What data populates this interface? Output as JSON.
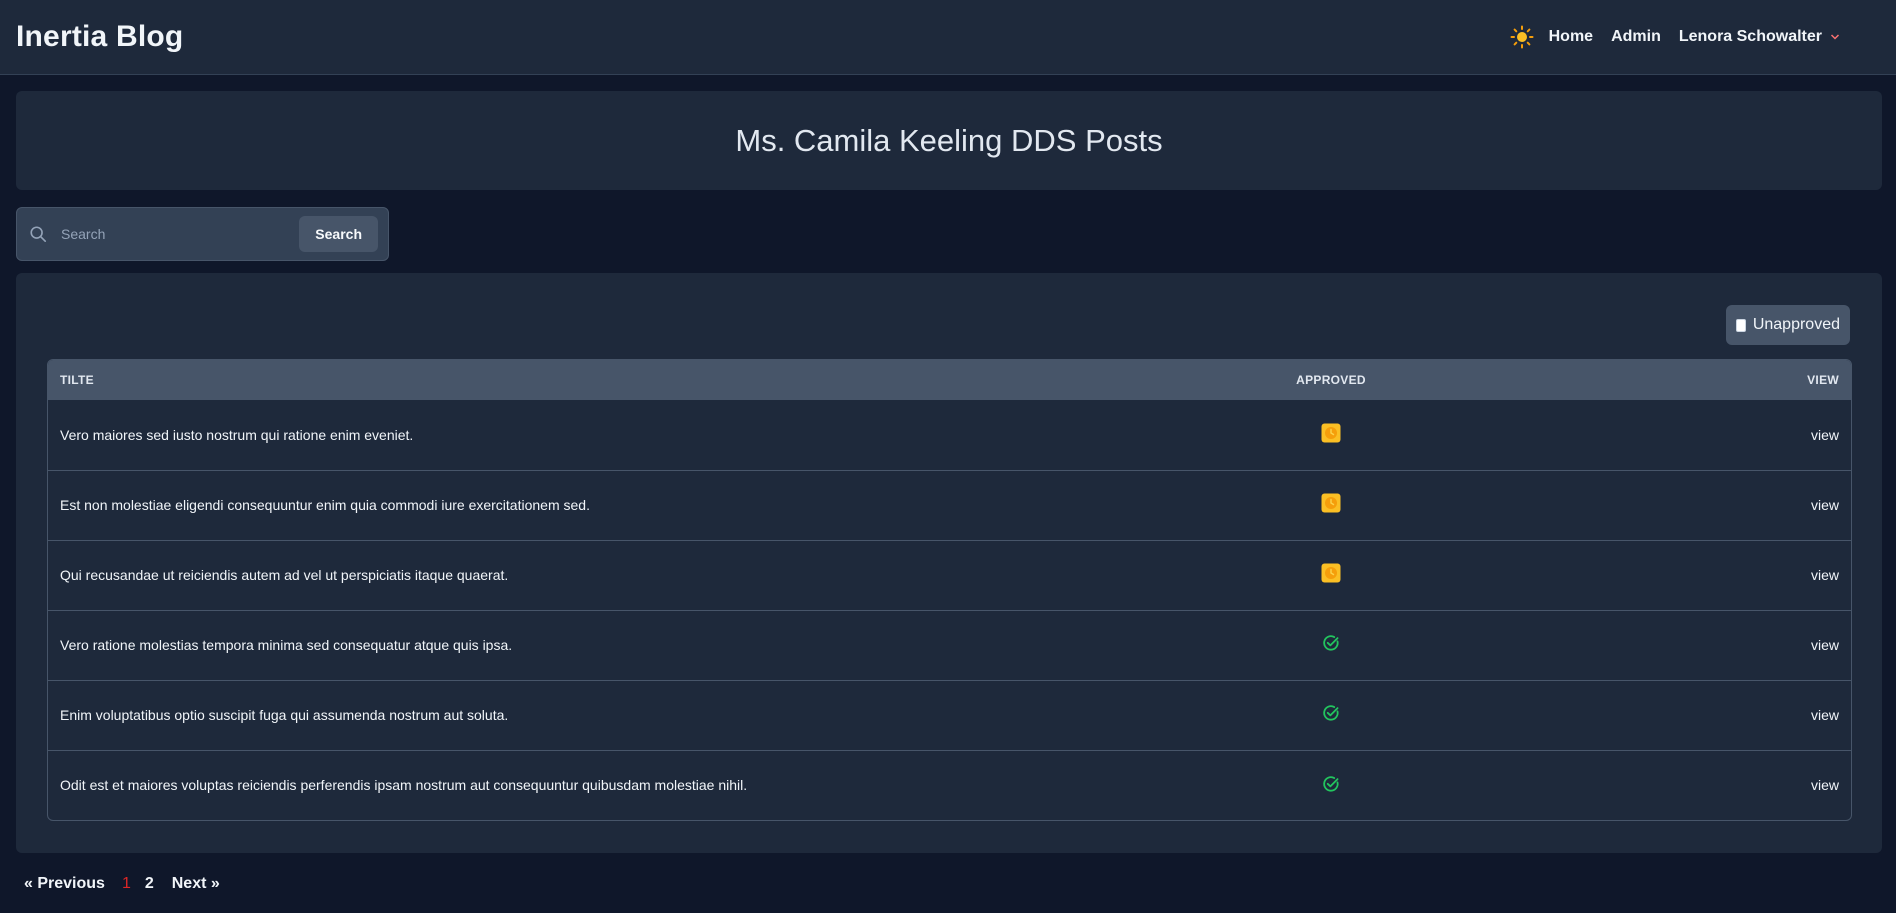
{
  "nav": {
    "brand": "Inertia Blog",
    "theme_icon": "sun-icon",
    "links": [
      "Home",
      "Admin"
    ],
    "user": "Lenora Schowalter"
  },
  "header": {
    "title": "Ms. Camila Keeling DDS Posts"
  },
  "search": {
    "placeholder": "Search",
    "value": "",
    "button": "Search"
  },
  "filter": {
    "label": "Unapproved",
    "checked": false
  },
  "table": {
    "columns": [
      "TILTE",
      "APPROVED",
      "VIEW"
    ],
    "rows": [
      {
        "title": "Vero maiores sed iusto nostrum qui ratione enim eveniet.",
        "status": "pending",
        "view": "view"
      },
      {
        "title": "Est non molestiae eligendi consequuntur enim quia commodi iure exercitationem sed.",
        "status": "pending",
        "view": "view"
      },
      {
        "title": "Qui recusandae ut reiciendis autem ad vel ut perspiciatis itaque quaerat.",
        "status": "pending",
        "view": "view"
      },
      {
        "title": "Vero ratione molestias tempora minima sed consequatur atque quis ipsa.",
        "status": "approved",
        "view": "view"
      },
      {
        "title": "Enim voluptatibus optio suscipit fuga qui assumenda nostrum aut soluta.",
        "status": "approved",
        "view": "view"
      },
      {
        "title": "Odit est et maiores voluptas reiciendis perferendis ipsam nostrum aut consequuntur quibusdam molestiae nihil.",
        "status": "approved",
        "view": "view"
      }
    ]
  },
  "pagination": {
    "prev": "« Previous",
    "pages": [
      "1",
      "2"
    ],
    "current": "1",
    "next": "Next »"
  },
  "colors": {
    "accent_current_page": "#dc2626",
    "approved": "#22c55e",
    "pending": "#f59e0b"
  }
}
